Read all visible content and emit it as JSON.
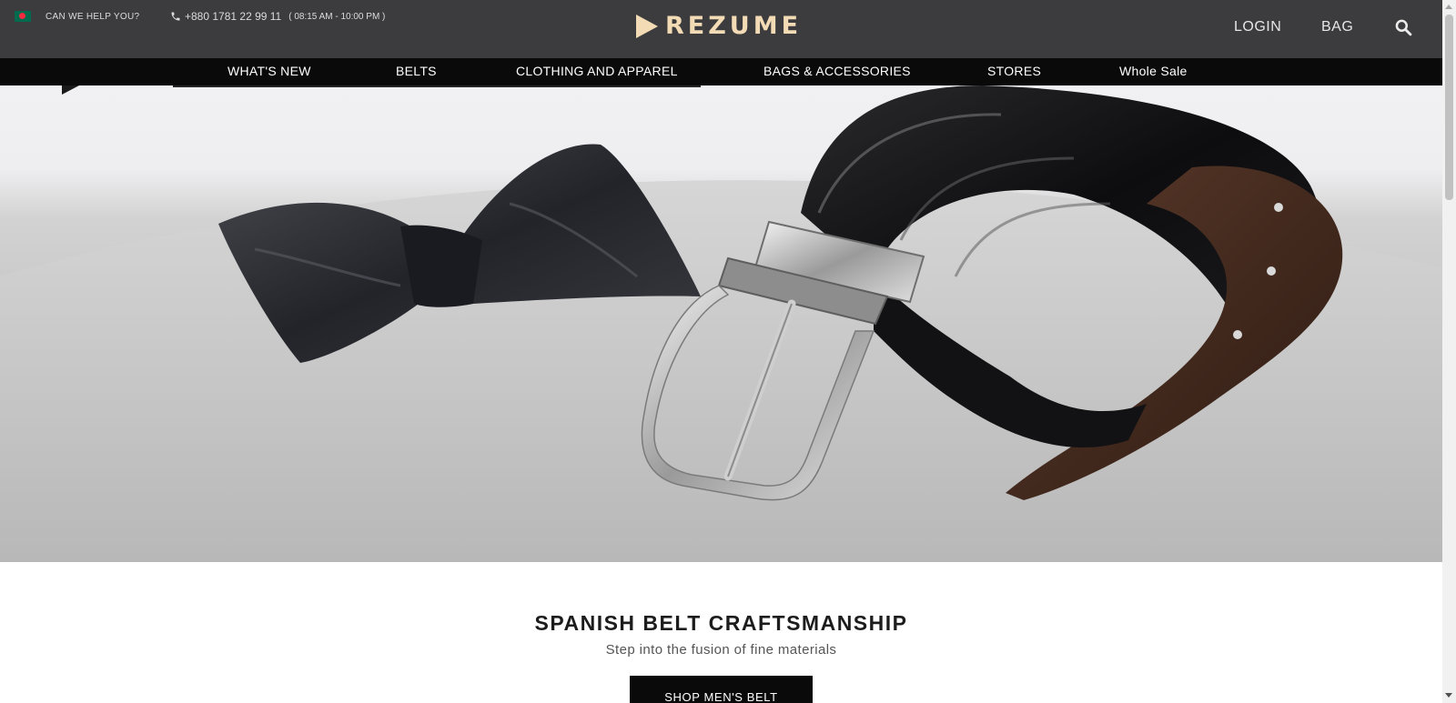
{
  "header": {
    "help_text": "CAN WE HELP YOU?",
    "phone": "+880 1781 22 99 11",
    "hours": "( 08:15 AM - 10:00 PM )",
    "logo_text": "REZUME",
    "login_label": "LOGIN",
    "bag_label": "BAG",
    "search_icon": "search-icon",
    "logo_color": "#f3dcb5",
    "bar_color": "#3c3c3e"
  },
  "nav": {
    "items": [
      {
        "label": "WHAT'S NEW"
      },
      {
        "label": "BELTS"
      },
      {
        "label": "CLOTHING AND APPAREL"
      },
      {
        "label": "BAGS & ACCESSORIES"
      },
      {
        "label": "STORES"
      },
      {
        "label": "Whole Sale"
      }
    ]
  },
  "hero": {
    "image": "black-leather-belt-and-bow-tie"
  },
  "section": {
    "title": "SPANISH BELT CRAFTSMANSHIP",
    "subtitle": "Step into the fusion of fine materials",
    "button_label": "SHOP MEN'S BELT"
  }
}
